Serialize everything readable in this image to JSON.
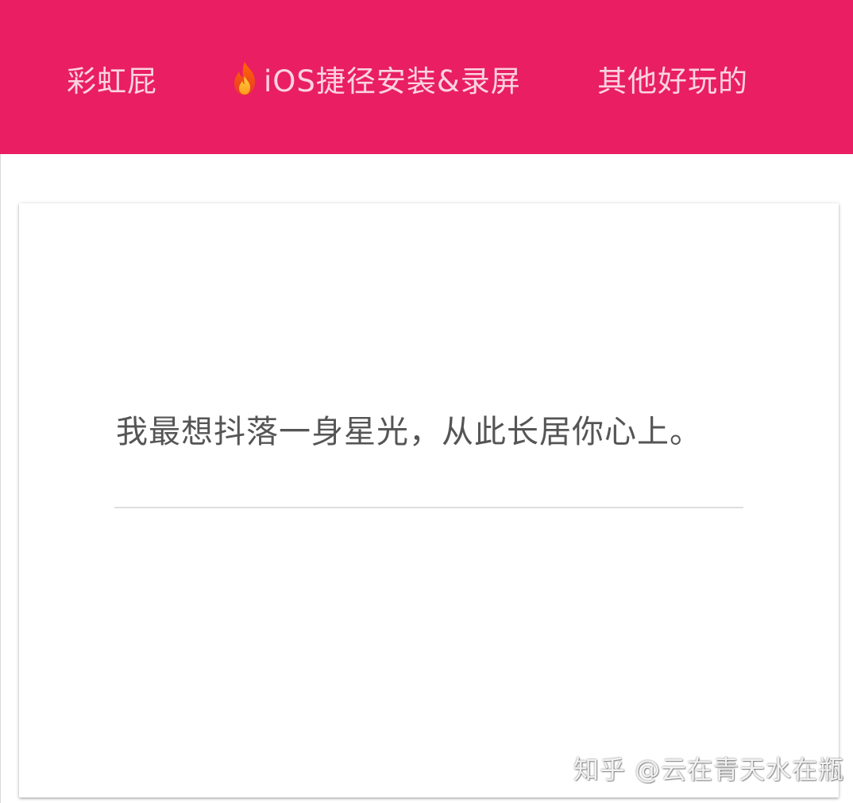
{
  "colors": {
    "header_background": "#e91e63",
    "nav_text": "#fbd3e0",
    "quote_text": "#555555",
    "card_background": "#ffffff"
  },
  "nav": {
    "items": [
      {
        "label": "彩虹屁"
      },
      {
        "label": "iOS捷径安装&录屏",
        "icon": "fire-icon"
      },
      {
        "label": "其他好玩的"
      }
    ]
  },
  "card": {
    "quote": "我最想抖落一身星光，从此长居你心上。"
  },
  "watermark": {
    "text": "知乎 @云在青天水在瓶"
  }
}
